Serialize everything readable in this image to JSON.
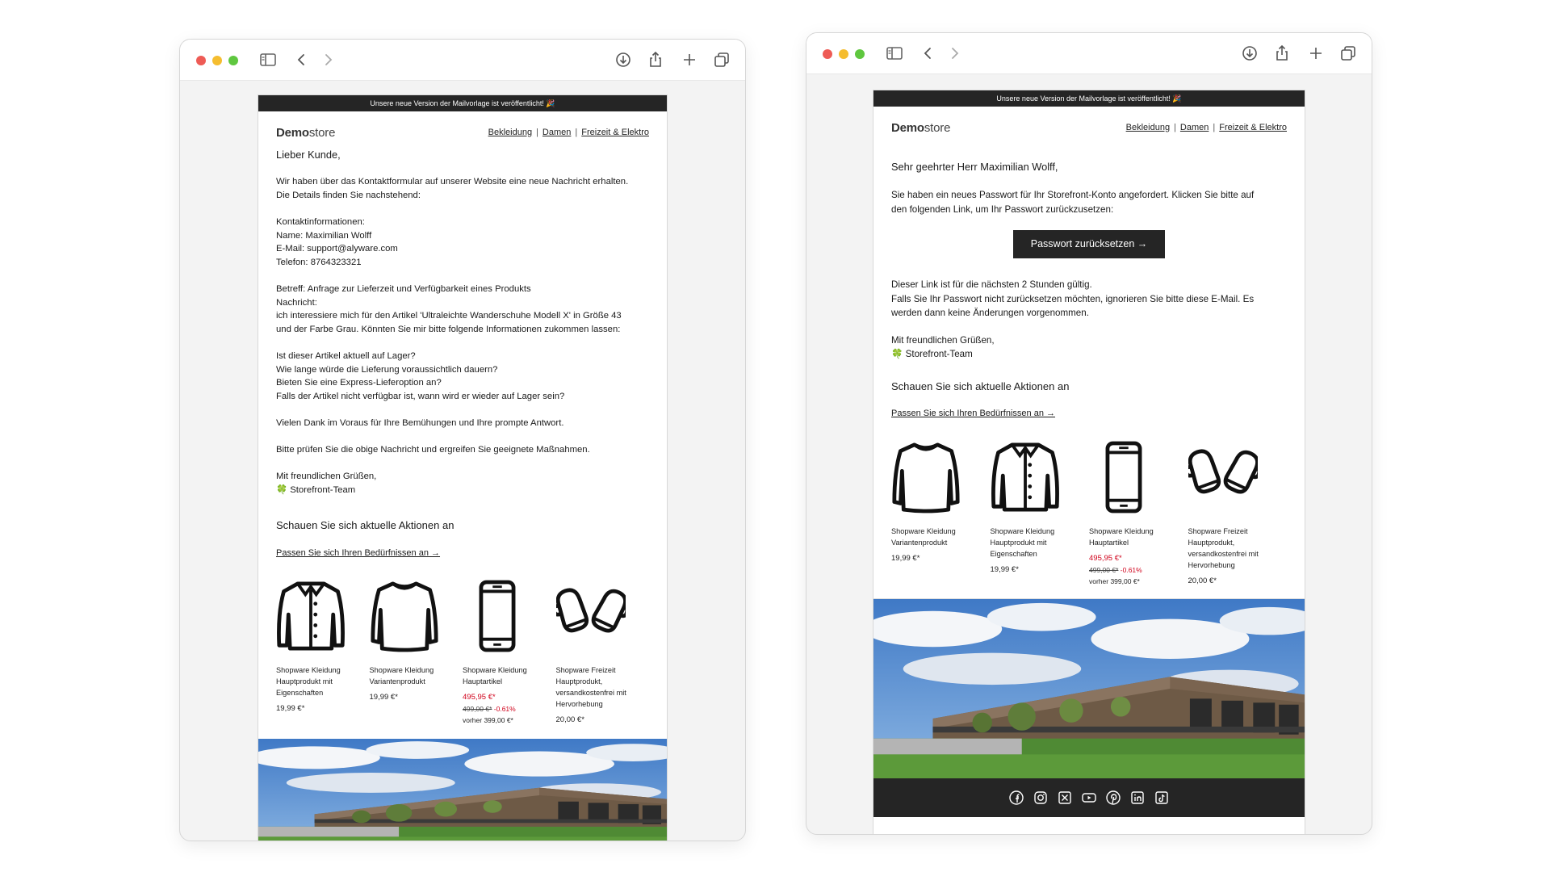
{
  "left": {
    "banner": "Unsere neue Version der Mailvorlage ist veröffentlicht! 🎉",
    "logo_bold": "Demo",
    "logo_rest": "store",
    "nav": [
      "Bekleidung",
      "Damen",
      "Freizeit & Elektro"
    ],
    "greeting": "Lieber Kunde,",
    "intro": [
      "Wir haben über das Kontaktformular auf unserer Website eine neue Nachricht erhalten.",
      "Die Details finden Sie nachstehend:"
    ],
    "contact": [
      "Kontaktinformationen:",
      "Name: Maximilian Wolff",
      "E-Mail: support@alyware.com",
      "Telefon: 8764323321"
    ],
    "message": [
      "Betreff: Anfrage zur Lieferzeit und Verfügbarkeit eines Produkts",
      "Nachricht:",
      "ich interessiere mich für den Artikel 'Ultraleichte Wanderschuhe Modell X' in Größe 43",
      "und der Farbe Grau. Könnten Sie mir bitte folgende Informationen zukommen lassen:"
    ],
    "questions": [
      "Ist dieser Artikel aktuell auf Lager?",
      "Wie lange würde die Lieferung voraussichtlich dauern?",
      "Bieten Sie eine Express-Lieferoption an?",
      "Falls der Artikel nicht verfügbar ist, wann wird er wieder auf Lager sein?"
    ],
    "thanks": "Vielen Dank im Voraus für Ihre Bemühungen und Ihre prompte Antwort.",
    "action": "Bitte prüfen Sie die obige Nachricht und ergreifen Sie geeignete Maßnahmen.",
    "closing": "Mit freundlichen Grüßen,",
    "team": "🍀 Storefront-Team",
    "promo_title": "Schauen Sie sich aktuelle Aktionen an",
    "promo_link": "Passen Sie sich Ihren Bedürfnissen an →",
    "products": [
      {
        "icon": "jacket-icon",
        "name": "Shopware Kleidung Hauptprodukt mit Eigenschaften",
        "price": "19,99 €*"
      },
      {
        "icon": "sweater-icon",
        "name": "Shopware Kleidung Variantenprodukt",
        "price": "19,99 €*"
      },
      {
        "icon": "phone-icon",
        "name": "Shopware Kleidung Hauptartikel",
        "sale_price": "495,95 €*",
        "old_price": "499,00 €*",
        "discount": "-0.61%",
        "before": "vorher 399,00 €*"
      },
      {
        "icon": "mittens-icon",
        "name": "Shopware Freizeit Hauptprodukt, versandkostenfrei mit Hervorhebung",
        "price": "20,00 €*"
      }
    ]
  },
  "right": {
    "banner": "Unsere neue Version der Mailvorlage ist veröffentlicht! 🎉",
    "logo_bold": "Demo",
    "logo_rest": "store",
    "nav": [
      "Bekleidung",
      "Damen",
      "Freizeit & Elektro"
    ],
    "greeting": "Sehr geehrter Herr Maximilian Wolff,",
    "intro": [
      "Sie haben ein neues Passwort für Ihr Storefront-Konto angefordert. Klicken Sie bitte auf",
      "den folgenden Link, um Ihr Passwort zurückzusetzen:"
    ],
    "button": "Passwort zurücksetzen →",
    "validity": [
      "Dieser Link ist für die nächsten 2 Stunden gültig.",
      "Falls Sie Ihr Passwort nicht zurücksetzen möchten, ignorieren Sie bitte diese E-Mail. Es",
      "werden dann keine Änderungen vorgenommen."
    ],
    "closing": "Mit freundlichen Grüßen,",
    "team": "🍀 Storefront-Team",
    "promo_title": "Schauen Sie sich aktuelle Aktionen an",
    "promo_link": "Passen Sie sich Ihren Bedürfnissen an →",
    "products": [
      {
        "icon": "sweater-icon",
        "name": "Shopware Kleidung Variantenprodukt",
        "price": "19,99 €*"
      },
      {
        "icon": "jacket-icon",
        "name": "Shopware Kleidung Hauptprodukt mit Eigenschaften",
        "price": "19,99 €*"
      },
      {
        "icon": "phone-icon",
        "name": "Shopware Kleidung Hauptartikel",
        "sale_price": "495,95 €*",
        "old_price": "499,00 €*",
        "discount": "-0.61%",
        "before": "vorher 399,00 €*"
      },
      {
        "icon": "mittens-icon",
        "name": "Shopware Freizeit Hauptprodukt, versandkostenfrei mit Hervorhebung",
        "price": "20,00 €*"
      }
    ],
    "social": [
      "facebook-icon",
      "instagram-icon",
      "x-icon",
      "youtube-icon",
      "pinterest-icon",
      "linkedin-icon",
      "tiktok-icon"
    ]
  },
  "colors": {
    "banner_bg": "#252525",
    "sale_red": "#d0021b",
    "traffic_red": "#ee5b55",
    "traffic_yellow": "#f5bd2f",
    "traffic_green": "#5fc73f"
  }
}
